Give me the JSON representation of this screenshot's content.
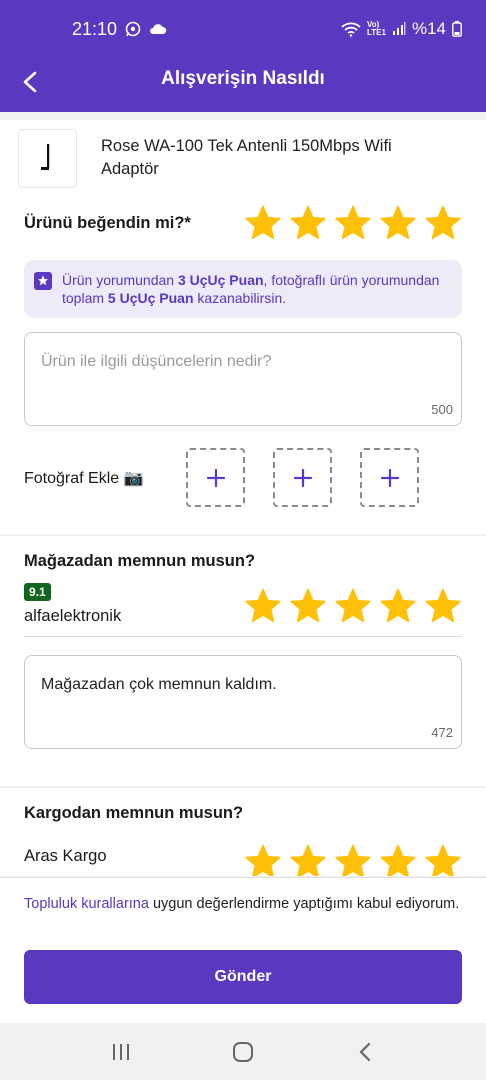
{
  "status_bar": {
    "time": "21:10",
    "network": "Vo)\nLTE1",
    "battery": "%14"
  },
  "header": {
    "title": "Alışverişin Nasıldı"
  },
  "product": {
    "name_line1": "Rose WA-100 Tek Antenli 150Mbps Wifi",
    "name_line2": "Adaptör"
  },
  "product_rating": {
    "question": "Ürünü beğendin mi?*",
    "rating": 5,
    "max": 5
  },
  "points_info": {
    "text1": "Ürün yorumundan ",
    "bold1": "3 UçUç Puan",
    "text2": ", fotoğraflı ürün yorumundan toplam ",
    "bold2": "5 UçUç Puan",
    "text3": " kazanabilirsin."
  },
  "product_review": {
    "placeholder": "Ürün ile ilgili düşüncelerin nedir?",
    "counter": "500"
  },
  "photo": {
    "label": "Fotoğraf Ekle 📷",
    "slot_symbol": "+"
  },
  "store_rating": {
    "question": "Mağazadan memnun musun?",
    "score": "9.1",
    "store_name": "alfaelektronik",
    "rating": 5,
    "max": 5
  },
  "store_review": {
    "value": "Mağazadan çok memnun kaldım.",
    "counter": "472"
  },
  "cargo_rating": {
    "question": "Kargodan memnun musun?",
    "company": "Aras Kargo",
    "rating": 5,
    "max": 5
  },
  "terms": {
    "link": "Topluluk kurallarına",
    "text": " uygun değerlendirme yaptığımı kabul ediyorum."
  },
  "submit": {
    "label": "Gönder"
  },
  "colors": {
    "brand": "#5a38bf",
    "star": "#ffc107",
    "score_badge": "#10651f"
  },
  "icons": [
    "whatsapp-icon",
    "cloud-icon",
    "wifi-icon",
    "signal-icon",
    "battery-icon",
    "back-arrow-icon",
    "star-icon",
    "badge-star-icon",
    "plus-icon",
    "camera-icon",
    "recent-apps-icon",
    "home-icon",
    "nav-back-icon"
  ]
}
